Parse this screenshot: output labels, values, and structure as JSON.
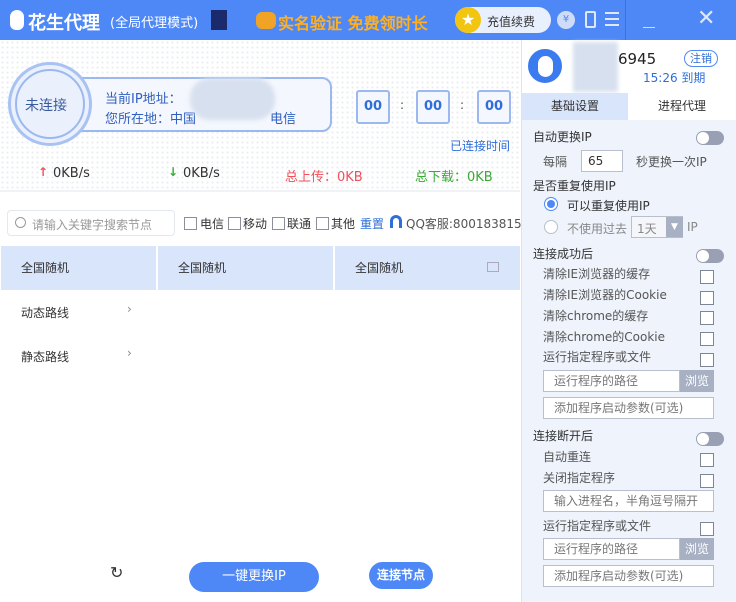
{
  "titlebar": {
    "app_name": "花生代理",
    "mode": "(全局代理模式)",
    "promo": "实名验证 免费领时长",
    "recharge": "充值续费"
  },
  "status": {
    "state": "未连接",
    "ip_label": "当前IP地址：",
    "location_label": "您所在地：中国",
    "location_isp": "电信",
    "timer": [
      "00",
      "00",
      "00"
    ],
    "timer_label": "已连接时间"
  },
  "traffic": {
    "up_speed": "0KB/s",
    "down_speed": "0KB/s",
    "total_up": "总上传：0KB",
    "total_down": "总下载：0KB"
  },
  "filter": {
    "search_placeholder": "请输入关键字搜索节点",
    "isps": [
      "电信",
      "移动",
      "联通",
      "其他"
    ],
    "reset": "重置",
    "qq": "QQ客服:800183815"
  },
  "nodes": {
    "columns": [
      "全国随机",
      "全国随机",
      "全国随机"
    ],
    "routes": [
      "动态路线",
      "静态路线"
    ]
  },
  "actions": {
    "change_ip": "一键更换IP",
    "connect": "连接节点"
  },
  "account": {
    "id_suffix": "6945",
    "logout": "注销",
    "expiry": "15:26 到期"
  },
  "tabs": [
    "基础设置",
    "进程代理"
  ],
  "settings": {
    "auto_change": "自动更换IP",
    "every": "每隔",
    "interval": "65",
    "per_sec": "秒更换一次IP",
    "reuse": "是否重复使用IP",
    "reuse_yes": "可以重复使用IP",
    "reuse_no": "不使用过去",
    "reuse_period": "1天",
    "ip": "IP",
    "after_connect": "连接成功后",
    "after_connect_items": [
      "清除IE浏览器的缓存",
      "清除IE浏览器的Cookie",
      "清除chrome的缓存",
      "清除chrome的Cookie",
      "运行指定程序或文件"
    ],
    "path_placeholder": "运行程序的路径",
    "browse": "浏览",
    "args_placeholder": "添加程序启动参数(可选)",
    "after_disconnect": "连接断开后",
    "auto_reconnect": "自动重连",
    "close_program": "关闭指定程序",
    "process_placeholder": "输入进程名，半角逗号隔开",
    "run_program": "运行指定程序或文件"
  },
  "colors": {
    "brand": "#4e88f6",
    "upload": "#f0505a",
    "download": "#3aaa35",
    "link": "#2f6ed8"
  }
}
